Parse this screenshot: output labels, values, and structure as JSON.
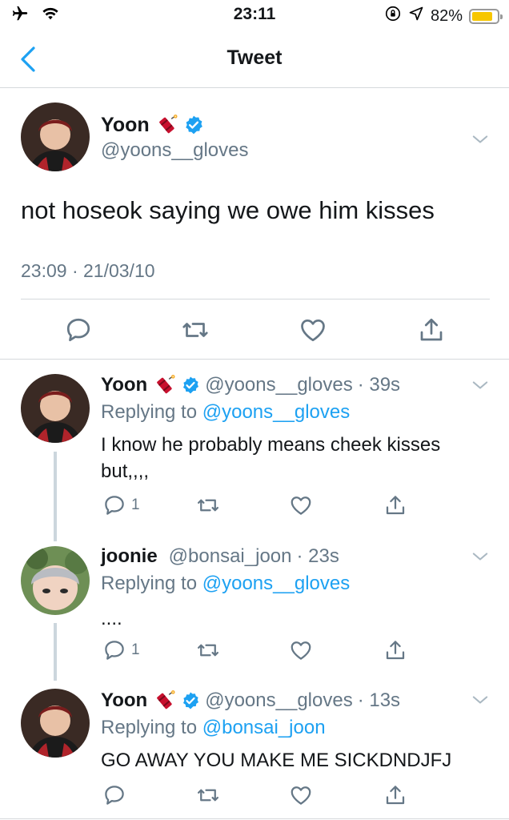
{
  "status_bar": {
    "time": "23:11",
    "battery": "82%",
    "battery_level": 0.82
  },
  "nav": {
    "title": "Tweet"
  },
  "main_tweet": {
    "name": "Yoon",
    "emoji": "firecracker",
    "handle": "@yoons__gloves",
    "text": "not hoseok saying we owe him kisses",
    "timestamp": "23:09 · 21/03/10"
  },
  "replies": [
    {
      "name": "Yoon",
      "emoji": "firecracker",
      "verified": true,
      "handle": "@yoons__gloves",
      "time": "· 39s",
      "replying_label": "Replying to",
      "replying_to": "@yoons__gloves",
      "text": "I know he probably means cheek kisses but,,,,",
      "reply_count": "1"
    },
    {
      "name": "joonie",
      "verified": false,
      "handle": "@bonsai_joon",
      "time": "· 23s",
      "replying_label": "Replying to",
      "replying_to": "@yoons__gloves",
      "text": "....",
      "reply_count": "1"
    },
    {
      "name": "Yoon",
      "emoji": "firecracker",
      "verified": true,
      "handle": "@yoons__gloves",
      "time": "· 13s",
      "replying_label": "Replying to",
      "replying_to": "@bonsai_joon",
      "text": "GO AWAY YOU MAKE ME SICKDNDJFJ",
      "reply_count": ""
    }
  ],
  "colors": {
    "accent": "#1da1f2",
    "grey_text": "#657786",
    "divider": "#d5d9dc",
    "battery": "#f7c600"
  }
}
